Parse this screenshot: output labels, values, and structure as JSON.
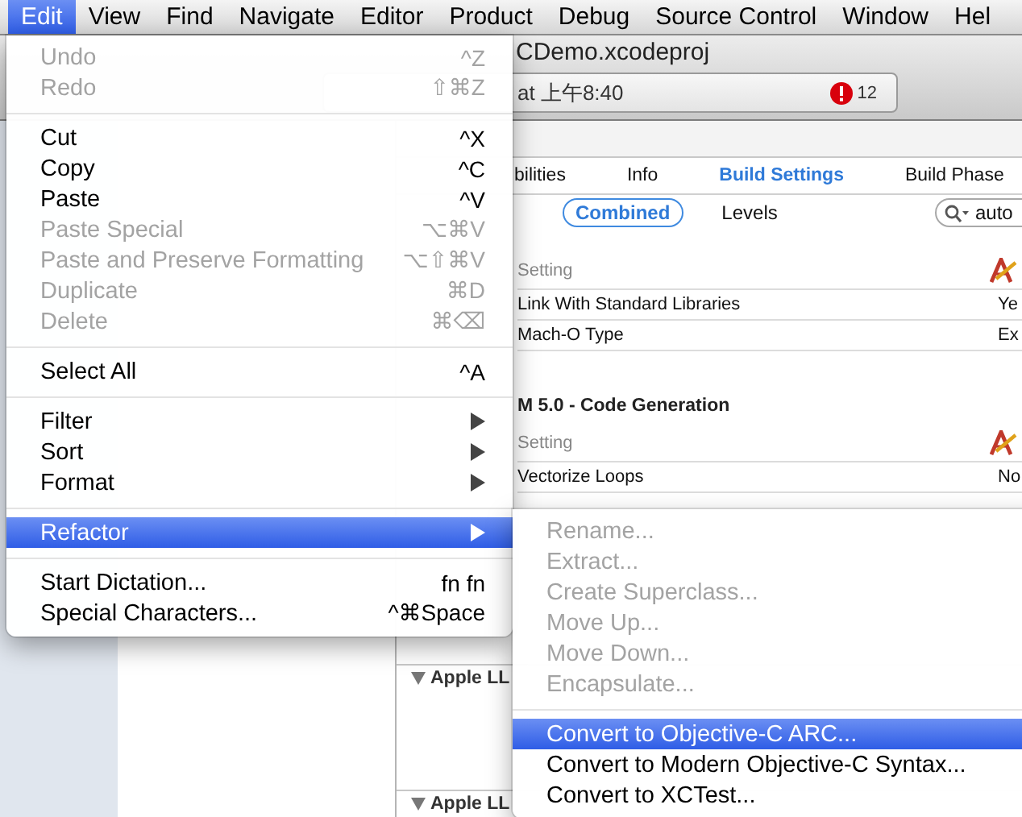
{
  "menu_bar": [
    {
      "label": "Edit",
      "selected": true
    },
    {
      "label": "View",
      "selected": false
    },
    {
      "label": "Find",
      "selected": false
    },
    {
      "label": "Navigate",
      "selected": false
    },
    {
      "label": "Editor",
      "selected": false
    },
    {
      "label": "Product",
      "selected": false
    },
    {
      "label": "Debug",
      "selected": false
    },
    {
      "label": "Source Control",
      "selected": false
    },
    {
      "label": "Window",
      "selected": false
    },
    {
      "label": "Hel",
      "selected": false
    }
  ],
  "window": {
    "title": "CDemo.xcodeproj",
    "activity": {
      "status": "at 上午8:40",
      "error_count": "12"
    }
  },
  "tabs": [
    {
      "label": "bilities",
      "selected": false
    },
    {
      "label": "Info",
      "selected": false
    },
    {
      "label": "Build Settings",
      "selected": true
    },
    {
      "label": "Build Phase",
      "selected": false
    }
  ],
  "filters": [
    {
      "label": "Combined",
      "selected": true
    },
    {
      "label": "Levels",
      "selected": false
    }
  ],
  "search": {
    "value": "auto"
  },
  "sections": [
    {
      "header": "Setting",
      "rows": [
        {
          "setting": "Link With Standard Libraries",
          "value": "Ye"
        },
        {
          "setting": "Mach-O Type",
          "value": "Ex"
        }
      ]
    },
    {
      "title": "M 5.0 - Code Generation",
      "header": "Setting",
      "rows": [
        {
          "setting": "Vectorize Loops",
          "value": "No"
        }
      ]
    }
  ],
  "collapsed_sections": [
    {
      "title": "Apple LL"
    },
    {
      "title": "Apple LL"
    }
  ],
  "edit_menu": [
    {
      "kind": "item",
      "label": "Undo",
      "shortcut": "^Z",
      "disabled": true,
      "selected": false
    },
    {
      "kind": "item",
      "label": "Redo",
      "shortcut": "⇧⌘Z",
      "disabled": true,
      "selected": false
    },
    {
      "kind": "separator"
    },
    {
      "kind": "item",
      "label": "Cut",
      "shortcut": "^X",
      "disabled": false,
      "selected": false
    },
    {
      "kind": "item",
      "label": "Copy",
      "shortcut": "^C",
      "disabled": false,
      "selected": false
    },
    {
      "kind": "item",
      "label": "Paste",
      "shortcut": "^V",
      "disabled": false,
      "selected": false
    },
    {
      "kind": "item",
      "label": "Paste Special",
      "shortcut": "⌥⌘V",
      "disabled": true,
      "selected": false
    },
    {
      "kind": "item",
      "label": "Paste and Preserve Formatting",
      "shortcut": "⌥⇧⌘V",
      "disabled": true,
      "selected": false
    },
    {
      "kind": "item",
      "label": "Duplicate",
      "shortcut": "⌘D",
      "disabled": true,
      "selected": false
    },
    {
      "kind": "item",
      "label": "Delete",
      "shortcut": "⌘⌫",
      "disabled": true,
      "selected": false
    },
    {
      "kind": "separator"
    },
    {
      "kind": "item",
      "label": "Select All",
      "shortcut": "^A",
      "disabled": false,
      "selected": false
    },
    {
      "kind": "separator"
    },
    {
      "kind": "item",
      "label": "Filter",
      "submenu": true,
      "disabled": false,
      "selected": false
    },
    {
      "kind": "item",
      "label": "Sort",
      "submenu": true,
      "disabled": false,
      "selected": false
    },
    {
      "kind": "item",
      "label": "Format",
      "submenu": true,
      "disabled": false,
      "selected": false
    },
    {
      "kind": "separator"
    },
    {
      "kind": "item",
      "label": "Refactor",
      "submenu": true,
      "disabled": false,
      "selected": true
    },
    {
      "kind": "separator"
    },
    {
      "kind": "item",
      "label": "Start Dictation...",
      "shortcut": "fn fn",
      "disabled": false,
      "selected": false
    },
    {
      "kind": "item",
      "label": "Special Characters...",
      "shortcut": "^⌘Space",
      "disabled": false,
      "selected": false
    }
  ],
  "refactor_submenu": [
    {
      "kind": "item",
      "label": "Rename...",
      "disabled": true,
      "selected": false
    },
    {
      "kind": "item",
      "label": "Extract...",
      "disabled": true,
      "selected": false
    },
    {
      "kind": "item",
      "label": "Create Superclass...",
      "disabled": true,
      "selected": false
    },
    {
      "kind": "item",
      "label": "Move Up...",
      "disabled": true,
      "selected": false
    },
    {
      "kind": "item",
      "label": "Move Down...",
      "disabled": true,
      "selected": false
    },
    {
      "kind": "item",
      "label": "Encapsulate...",
      "disabled": true,
      "selected": false
    },
    {
      "kind": "separator"
    },
    {
      "kind": "item",
      "label": "Convert to Objective-C ARC...",
      "disabled": false,
      "selected": true
    },
    {
      "kind": "item",
      "label": "Convert to Modern Objective-C Syntax...",
      "disabled": false,
      "selected": false
    },
    {
      "kind": "item",
      "label": "Convert to XCTest...",
      "disabled": false,
      "selected": false
    }
  ]
}
